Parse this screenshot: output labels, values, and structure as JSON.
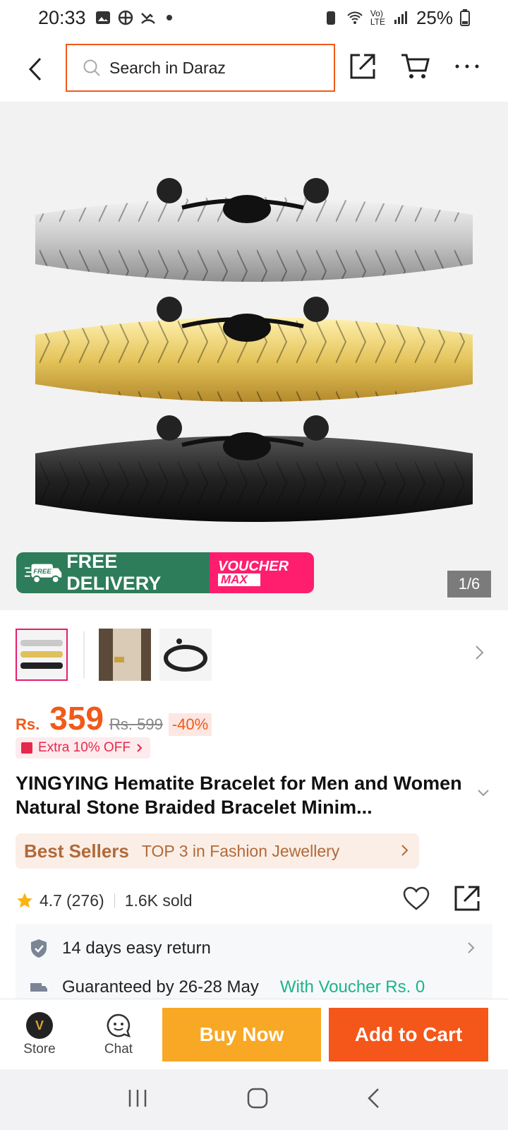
{
  "status_bar": {
    "time": "20:33",
    "battery": "25%"
  },
  "header": {
    "search_placeholder": "Search in Daraz",
    "icons": [
      "back-icon",
      "search-icon",
      "share-icon",
      "cart-icon",
      "more-icon"
    ]
  },
  "gallery": {
    "pager": "1/6",
    "promo_free": "FREE DELIVERY",
    "promo_free_badge": "FREE",
    "promo_voucher": "VOUCHER",
    "promo_voucher_max": "MAX"
  },
  "product": {
    "currency": "Rs.",
    "price": "359",
    "old_price": "Rs. 599",
    "discount": "-40%",
    "extra_offer": "Extra 10% OFF",
    "title": "YINGYING Hematite Bracelet for Men and Women Natural Stone Braided Bracelet Minim...",
    "best_sellers_label": "Best Sellers",
    "best_sellers_text": "TOP 3 in Fashion Jewellery",
    "rating": "4.7",
    "reviews": "(276)",
    "sold": "1.6K sold"
  },
  "info": {
    "return_text": "14 days easy return",
    "delivery_text": "Guaranteed by 26-28 May",
    "voucher_text": "With Voucher Rs. 0"
  },
  "action_bar": {
    "store_label": "Store",
    "chat_label": "Chat",
    "buy_now": "Buy Now",
    "add_to_cart": "Add to Cart"
  },
  "colors": {
    "accent": "#f05a1a",
    "buy_now": "#f8a824",
    "add_cart": "#f5561a",
    "free_delivery": "#2e7d5a",
    "voucher": "#ff1e6e"
  }
}
